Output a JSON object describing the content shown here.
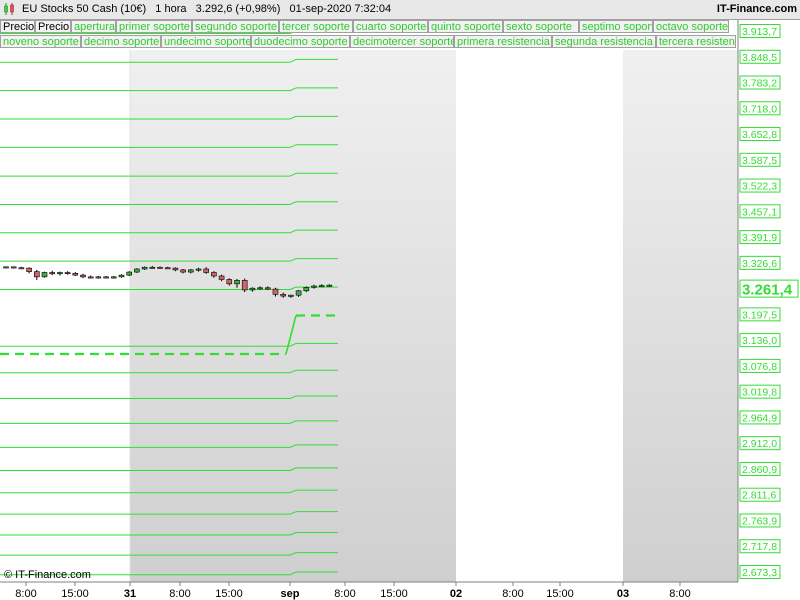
{
  "header": {
    "instrument": "EU Stocks 50 Cash (10€)",
    "timeframe": "1 hora",
    "price_change": "3.292,6 (+0,98%)",
    "datetime": "01-sep-2020 7:32:04",
    "brand": "IT-Finance.com"
  },
  "legend": {
    "row1": [
      "Precio",
      "Precio",
      "apertura",
      "primer soporte",
      "segundo soporte",
      "tercer soporte",
      "cuarto soporte",
      "quinto soporte",
      "sexto soporte",
      "septimo soporte",
      "octavo soporte"
    ],
    "row2": [
      "noveno soporte",
      "decimo soporte",
      "undecimo soporte",
      "duodecimo soporte",
      "decimotercer soporte",
      "primera resistencia",
      "segunda resistencia",
      "tercera resisten"
    ]
  },
  "watermark": "© IT-Finance.com",
  "colors": {
    "level_green": "#33dd33",
    "bull": "#3cb043",
    "bear": "#cc6666",
    "shade": "#cfcfcf"
  },
  "chart_data": {
    "type": "candlestick",
    "x_labels": [
      "8:00",
      "15:00",
      "31",
      "8:00",
      "15:00",
      "sep",
      "8:00",
      "15:00",
      "02",
      "8:00",
      "15:00",
      "03",
      "8:00"
    ],
    "y_labels": [
      "3.913,7",
      "3.848,5",
      "3.783,2",
      "3.718,0",
      "3.652,8",
      "3.587,5",
      "3.522,3",
      "3.457,1",
      "3.391,9",
      "3.326,6",
      "3.261,4",
      "3.197,5",
      "3.136,0",
      "3.076,8",
      "3.019,8",
      "2.964,9",
      "2.912,0",
      "2.860,9",
      "2.811,6",
      "2.763,9",
      "2.717,8",
      "2.673,3"
    ],
    "current_price_label": "3.261,4",
    "support_levels": [
      3913.7,
      3848.5,
      3783.2,
      3718.0,
      3652.8,
      3587.5,
      3522.3,
      3457.1,
      3391.9,
      3326.6,
      3197.5,
      3136.0,
      3076.8,
      3019.8,
      2964.9,
      2912.0,
      2860.9,
      2811.6,
      2763.9,
      2717.8,
      2673.3
    ],
    "previous_levels": [
      3908,
      3842,
      3777,
      3712,
      3647,
      3581,
      3516,
      3451,
      3386,
      3321,
      3236,
      3191,
      3130,
      3071,
      3014,
      2959,
      2906,
      2855,
      2806,
      2758,
      2712,
      2667
    ],
    "open_level_previous": 3236,
    "open_level_current": 3261.4,
    "candles": [
      [
        3372,
        3374,
        3370,
        3373
      ],
      [
        3373,
        3374,
        3369,
        3371
      ],
      [
        3371,
        3373,
        3368,
        3370
      ],
      [
        3370,
        3372,
        3358,
        3362
      ],
      [
        3362,
        3366,
        3343,
        3350
      ],
      [
        3350,
        3362,
        3348,
        3360
      ],
      [
        3360,
        3364,
        3354,
        3357
      ],
      [
        3357,
        3362,
        3353,
        3360
      ],
      [
        3360,
        3363,
        3355,
        3358
      ],
      [
        3358,
        3361,
        3352,
        3354
      ],
      [
        3354,
        3357,
        3347,
        3350
      ],
      [
        3350,
        3353,
        3346,
        3349
      ],
      [
        3349,
        3352,
        3346,
        3350
      ],
      [
        3350,
        3352,
        3347,
        3349
      ],
      [
        3349,
        3352,
        3346,
        3350
      ],
      [
        3350,
        3356,
        3348,
        3354
      ],
      [
        3354,
        3363,
        3352,
        3361
      ],
      [
        3361,
        3370,
        3359,
        3368
      ],
      [
        3368,
        3374,
        3366,
        3372
      ],
      [
        3372,
        3375,
        3369,
        3372
      ],
      [
        3372,
        3374,
        3369,
        3371
      ],
      [
        3371,
        3373,
        3368,
        3370
      ],
      [
        3370,
        3372,
        3363,
        3366
      ],
      [
        3366,
        3368,
        3358,
        3361
      ],
      [
        3361,
        3368,
        3358,
        3366
      ],
      [
        3366,
        3371,
        3362,
        3368
      ],
      [
        3368,
        3372,
        3357,
        3360
      ],
      [
        3360,
        3363,
        3348,
        3352
      ],
      [
        3352,
        3355,
        3340,
        3344
      ],
      [
        3344,
        3347,
        3330,
        3334
      ],
      [
        3334,
        3345,
        3325,
        3342
      ],
      [
        3342,
        3346,
        3315,
        3320
      ],
      [
        3320,
        3326,
        3316,
        3324
      ],
      [
        3324,
        3328,
        3320,
        3325
      ],
      [
        3325,
        3328,
        3320,
        3322
      ],
      [
        3322,
        3325,
        3305,
        3310
      ],
      [
        3310,
        3314,
        3302,
        3306
      ],
      [
        3306,
        3309,
        3302,
        3308
      ],
      [
        3308,
        3320,
        3304,
        3318
      ],
      [
        3318,
        3328,
        3315,
        3326
      ],
      [
        3326,
        3332,
        3323,
        3329
      ],
      [
        3329,
        3333,
        3326,
        3330
      ],
      [
        3330,
        3333,
        3328,
        3331
      ]
    ]
  }
}
